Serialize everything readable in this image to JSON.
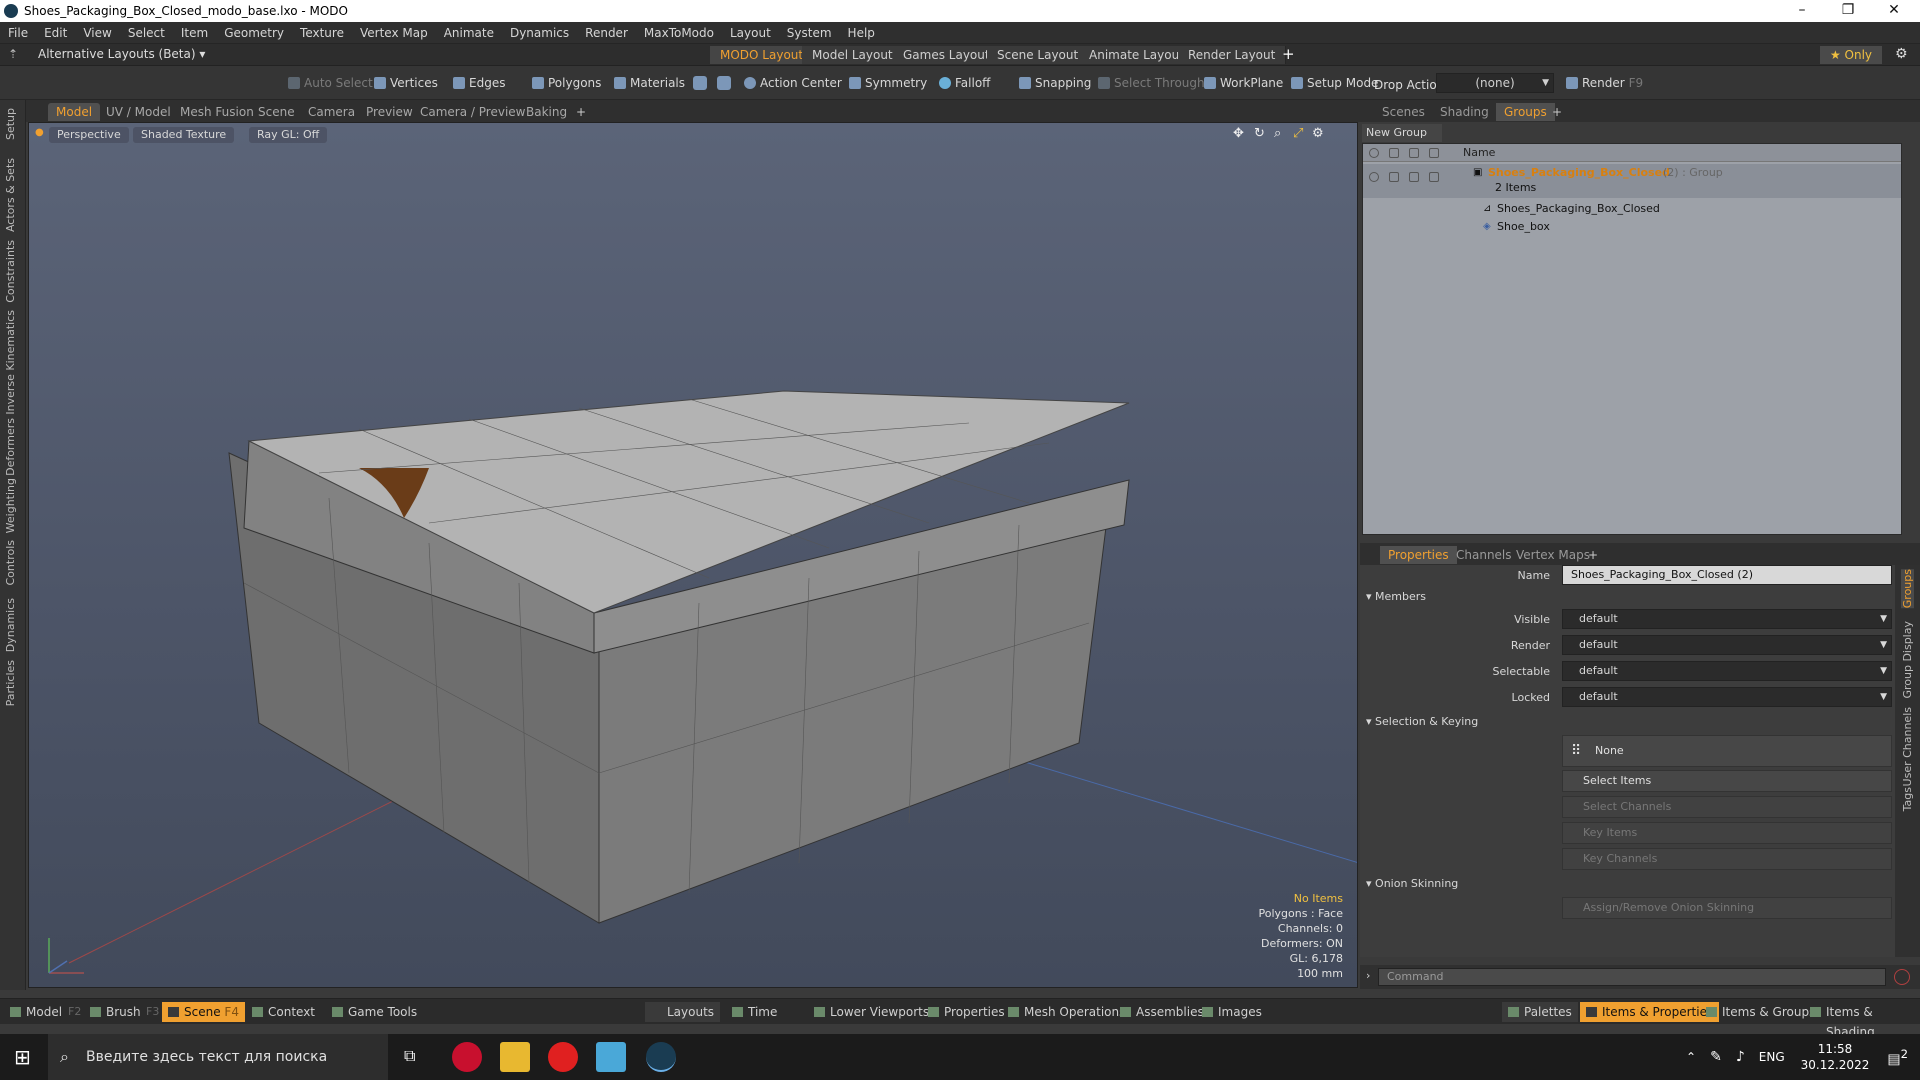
{
  "window": {
    "title": "Shoes_Packaging_Box_Closed_modo_base.lxo - MODO",
    "minimize": "–",
    "maximize": "❐",
    "close": "✕"
  },
  "menu": [
    "File",
    "Edit",
    "View",
    "Select",
    "Item",
    "Geometry",
    "Texture",
    "Vertex Map",
    "Animate",
    "Dynamics",
    "Render",
    "MaxToModo",
    "Layout",
    "System",
    "Help"
  ],
  "layoutbar": {
    "layout_switch": "Alternative Layouts (Beta) ▾",
    "tabs": [
      "MODO Layout",
      "Model Layout",
      "Games Layout",
      "Scene Layout",
      "Animate Layout",
      "Render Layout"
    ],
    "add": "+",
    "only": "★ Only"
  },
  "toolbar": {
    "auto_select": "Auto Select",
    "vertices": "Vertices",
    "edges": "Edges",
    "polygons": "Polygons",
    "materials": "Materials",
    "action_center": "Action Center",
    "symmetry": "Symmetry",
    "falloff": "Falloff",
    "snapping": "Snapping",
    "select_through": "Select Through",
    "workplane": "WorkPlane",
    "setup_mode": "Setup Mode",
    "drop_action": "Drop Action",
    "drop_value": "(none)",
    "render": "Render",
    "render_key": "F9"
  },
  "left_tabs": [
    "Setup",
    "Actors & Sets",
    "Constraints",
    "Inverse Kinematics",
    "Deformers",
    "Weighting",
    "Controls",
    "Dynamics",
    "Particles"
  ],
  "viewport_tabs": [
    "Model",
    "UV / Model",
    "Mesh Fusion",
    "Scene",
    "Camera",
    "Preview",
    "Camera / Preview",
    "Baking"
  ],
  "viewport": {
    "projection": "Perspective",
    "shading": "Shaded Texture",
    "raygl": "Ray GL: Off"
  },
  "stats": {
    "items": "No Items",
    "polygons": "Polygons : Face",
    "channels": "Channels: 0",
    "deformers": "Deformers: ON",
    "gl": "GL: 6,178",
    "scale": "100 mm"
  },
  "scene_tabs": [
    "Scenes",
    "Shading",
    "Groups"
  ],
  "groups": {
    "new_group": "New Group",
    "col_name": "Name",
    "group_name": "Shoes_Packaging_Box_Closed",
    "group_suffix": "(2) : Group",
    "count": "2 Items",
    "children": [
      "Shoes_Packaging_Box_Closed",
      "Shoe_box"
    ]
  },
  "props_tabs": [
    "Properties",
    "Channels",
    "Vertex Maps"
  ],
  "props": {
    "name_label": "Name",
    "name_value": "Shoes_Packaging_Box_Closed (2)",
    "members": "Members",
    "visible_label": "Visible",
    "visible": "default",
    "render_label": "Render",
    "render": "default",
    "selectable_label": "Selectable",
    "selectable": "default",
    "locked_label": "Locked",
    "locked": "default",
    "selection_keying": "Selection & Keying",
    "none_label": "None",
    "select_items": "Select Items",
    "select_channels": "Select Channels",
    "key_items": "Key Items",
    "key_channels": "Key Channels",
    "onion": "Onion Skinning",
    "assign_onion": "Assign/Remove Onion Skinning"
  },
  "side_tabs": [
    "Groups",
    "Group Display",
    "User Channels",
    "Tags"
  ],
  "command_placeholder": "Command",
  "bottom": {
    "model": "Model",
    "model_key": "F2",
    "brush": "Brush",
    "brush_key": "F3",
    "scene": "Scene",
    "scene_key": "F4",
    "context": "Context",
    "game_tools": "Game Tools",
    "layouts": "Layouts",
    "time": "Time",
    "lower_viewports": "Lower Viewports",
    "properties": "Properties",
    "mesh_operations": "Mesh Operations",
    "assemblies": "Assemblies",
    "images": "Images",
    "palettes": "Palettes",
    "items_properties": "Items & Properties",
    "items_groups": "Items & Groups",
    "items_shading": "Items & Shading"
  },
  "taskbar": {
    "search": "Введите здесь текст для поиска",
    "lang": "ENG",
    "time": "11:58",
    "date": "30.12.2022",
    "notify": "2"
  },
  "colors": {
    "accent": "#f0a030",
    "viewport_top": "#5b6478",
    "box_face": "#7b7b7b"
  }
}
